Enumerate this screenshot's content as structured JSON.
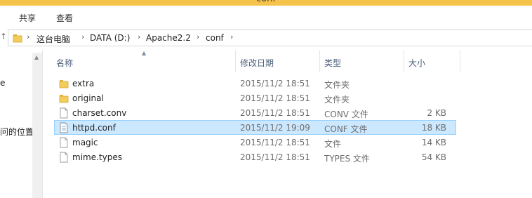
{
  "window": {
    "title": "conf"
  },
  "ribbon": {
    "tabs": [
      {
        "label": "共享"
      },
      {
        "label": "查看"
      }
    ]
  },
  "address": {
    "crumbs": [
      "这台电脑",
      "DATA (D:)",
      "Apache2.2",
      "conf"
    ]
  },
  "nav": {
    "partial_items": [
      "e",
      "问的位置"
    ]
  },
  "columns": {
    "name": "名称",
    "date": "修改日期",
    "type": "类型",
    "size": "大小"
  },
  "files": [
    {
      "name": "extra",
      "date": "2015/11/2 18:51",
      "type": "文件夹",
      "size": "",
      "icon": "folder-icon"
    },
    {
      "name": "original",
      "date": "2015/11/2 18:51",
      "type": "文件夹",
      "size": "",
      "icon": "folder-icon"
    },
    {
      "name": "charset.conv",
      "date": "2015/11/2 18:51",
      "type": "CONV 文件",
      "size": "2 KB",
      "icon": "file-icon"
    },
    {
      "name": "httpd.conf",
      "date": "2015/11/2 19:09",
      "type": "CONF 文件",
      "size": "18 KB",
      "icon": "file-icon",
      "selected": true
    },
    {
      "name": "magic",
      "date": "2015/11/2 18:51",
      "type": "文件",
      "size": "14 KB",
      "icon": "file-icon"
    },
    {
      "name": "mime.types",
      "date": "2015/11/2 18:51",
      "type": "TYPES 文件",
      "size": "54 KB",
      "icon": "file-icon"
    }
  ],
  "colors": {
    "titlebar": "#f5c24a",
    "selection": "#cce8ff",
    "selection_border": "#99d1ff",
    "header_text": "#4c607a"
  }
}
